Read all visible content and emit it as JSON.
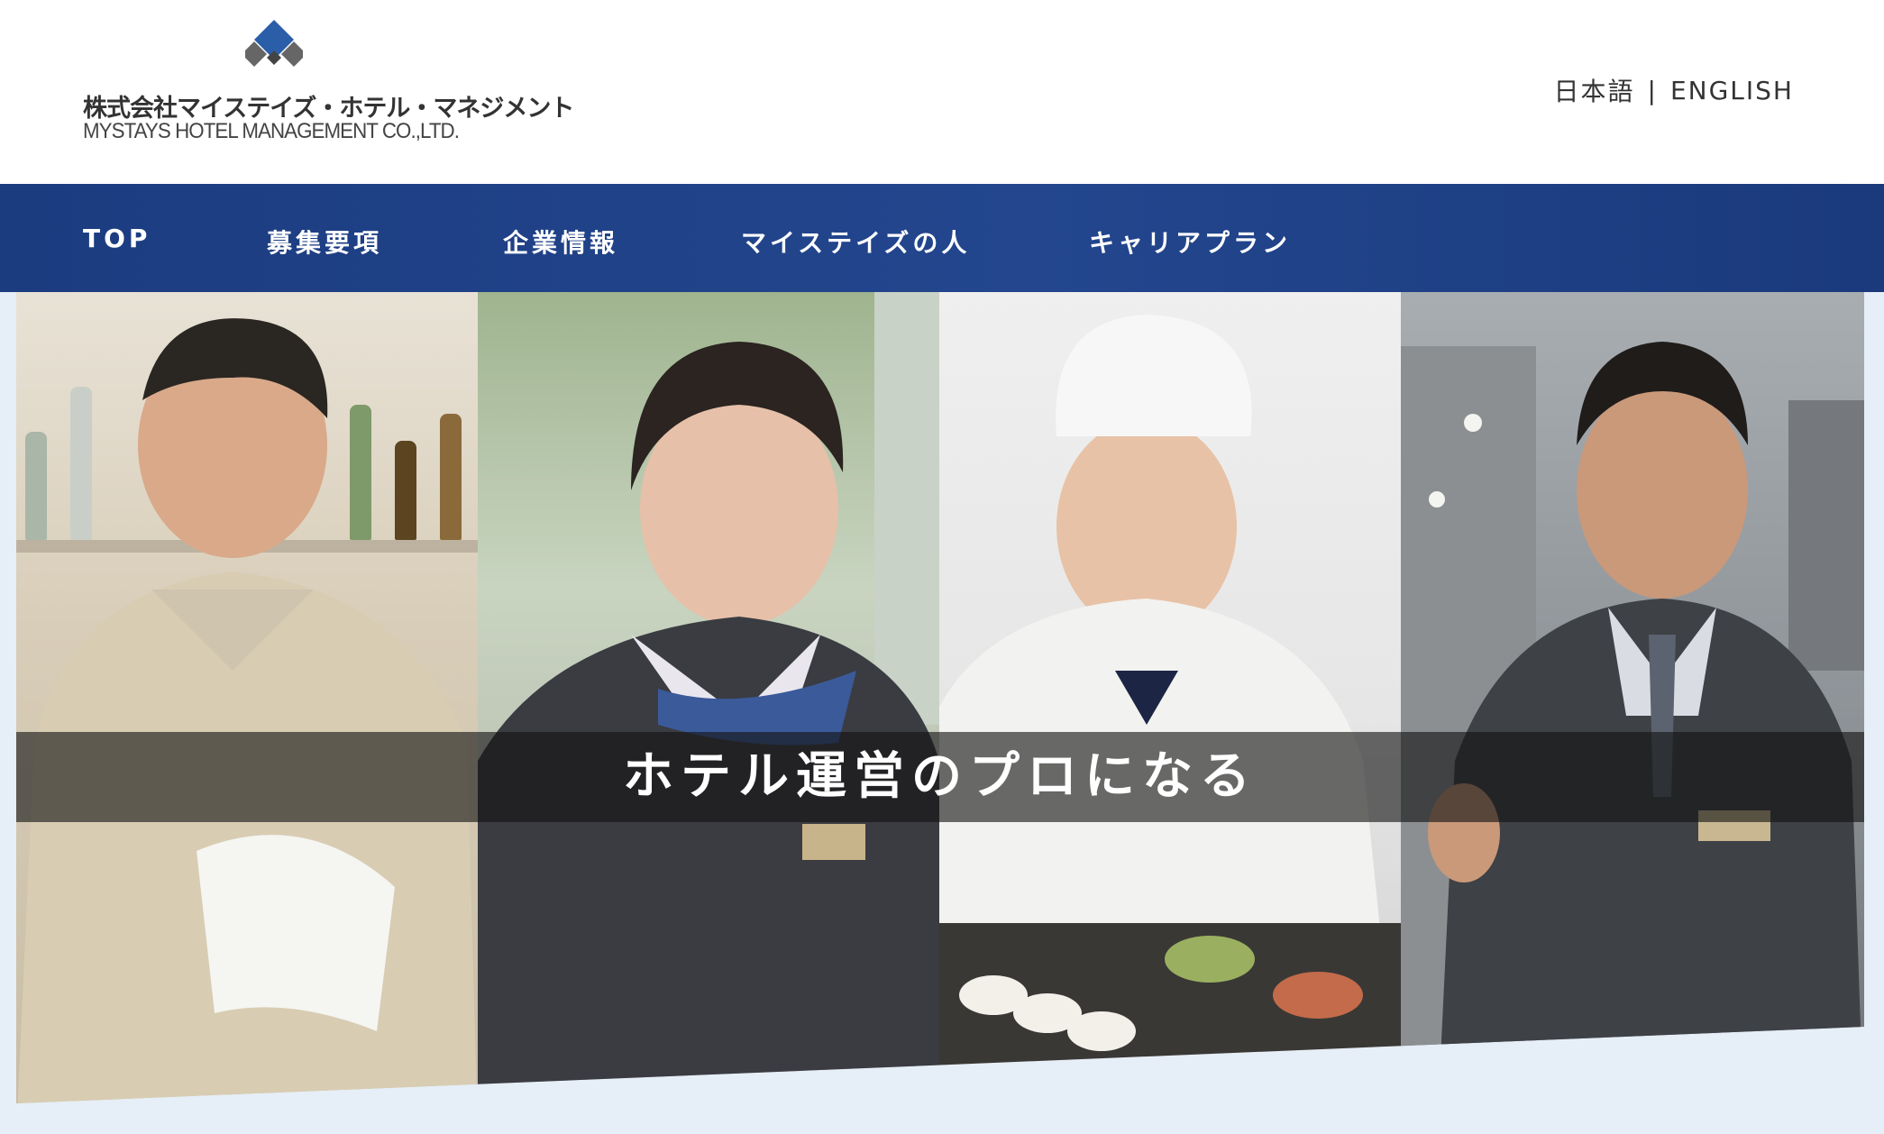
{
  "header": {
    "logo_jp": "株式会社マイステイズ・ホテル・マネジメント",
    "logo_en": "MYSTAYS HOTEL MANAGEMENT CO.,LTD.",
    "lang_ja": "日本語",
    "lang_separator": "|",
    "lang_en": "ENGLISH"
  },
  "nav": {
    "items": [
      {
        "label": "TOP"
      },
      {
        "label": "募集要項"
      },
      {
        "label": "企業情報"
      },
      {
        "label": "マイステイズの人"
      },
      {
        "label": "キャリアプラン"
      }
    ]
  },
  "hero": {
    "tagline": "ホテル運営のプロになる"
  },
  "colors": {
    "nav_bg": "#1f4288",
    "logo_blue": "#2b5ea8",
    "hero_bottom_bg": "#e6eef7"
  }
}
